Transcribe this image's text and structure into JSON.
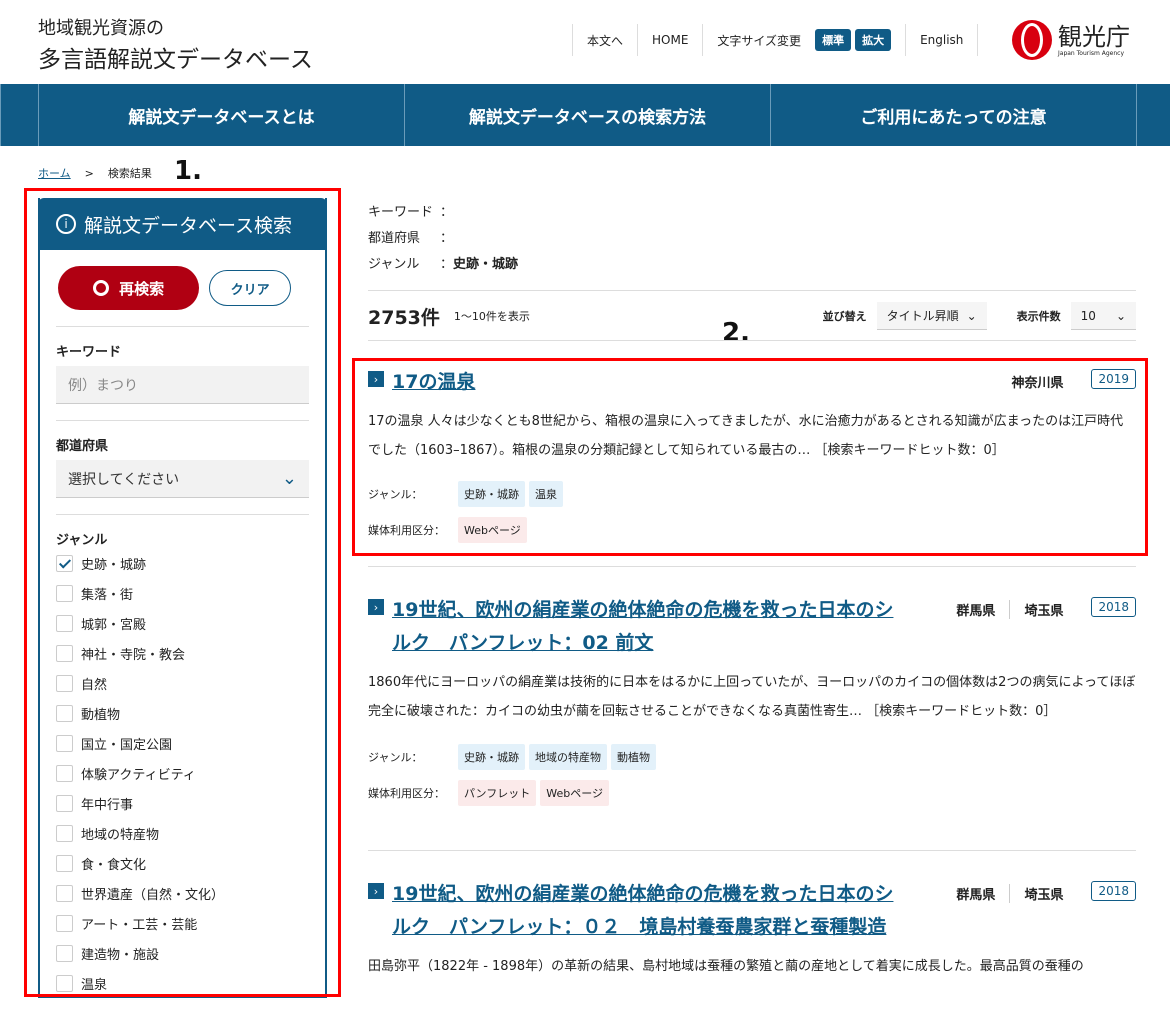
{
  "header": {
    "logo_line1": "地域観光資源の",
    "logo_line2": "多言語解説文データベース",
    "util": [
      "本文へ",
      "HOME",
      "文字サイズ変更"
    ],
    "size_std": "標準",
    "size_large": "拡大",
    "english": "English",
    "agency_name": "観光庁",
    "agency_en": "Japan Tourism Agency"
  },
  "nav": [
    "解説文データベースとは",
    "解説文データベースの検索方法",
    "ご利用にあたっての注意"
  ],
  "breadcrumb": {
    "home": "ホーム",
    "sep": ">",
    "current": "検索結果"
  },
  "annotations": {
    "a1": "1.",
    "a2": "2."
  },
  "sidebar": {
    "title": "解説文データベース検索",
    "search": "再検索",
    "clear": "クリア",
    "keyword_label": "キーワード",
    "keyword_placeholder": "例）まつり",
    "pref_label": "都道府県",
    "pref_value": "選択してください",
    "genre_label": "ジャンル",
    "genres": [
      {
        "label": "史跡・城跡",
        "checked": true
      },
      {
        "label": "集落・街",
        "checked": false
      },
      {
        "label": "城郭・宮殿",
        "checked": false
      },
      {
        "label": "神社・寺院・教会",
        "checked": false
      },
      {
        "label": "自然",
        "checked": false
      },
      {
        "label": "動植物",
        "checked": false
      },
      {
        "label": "国立・国定公園",
        "checked": false
      },
      {
        "label": "体験アクティビティ",
        "checked": false
      },
      {
        "label": "年中行事",
        "checked": false
      },
      {
        "label": "地域の特産物",
        "checked": false
      },
      {
        "label": "食・食文化",
        "checked": false
      },
      {
        "label": "世界遺産（自然・文化）",
        "checked": false
      },
      {
        "label": "アート・工芸・芸能",
        "checked": false
      },
      {
        "label": "建造物・施設",
        "checked": false
      },
      {
        "label": "温泉",
        "checked": false
      }
    ]
  },
  "criteria": {
    "keyword_label": "キーワード",
    "keyword_value": "",
    "pref_label": "都道府県",
    "pref_value": "",
    "genre_label": "ジャンル",
    "genre_value": "史跡・城跡"
  },
  "results_bar": {
    "count": "2753件",
    "range": "1〜10件を表示",
    "sort_label": "並び替え",
    "sort_value": "タイトル昇順",
    "per_page_label": "表示件数",
    "per_page_value": "10"
  },
  "results": [
    {
      "title": "17の温泉",
      "prefs": [
        "神奈川県"
      ],
      "year": "2019",
      "desc": "17の温泉 人々は少なくとも8世紀から、箱根の温泉に入ってきましたが、水に治癒力があるとされる知識が広まったのは江戸時代でした（1603–1867）。箱根の温泉の分類記録として知られている最古の… ［検索キーワードヒット数：0］",
      "genre_label": "ジャンル：",
      "genres": [
        "史跡・城跡",
        "温泉"
      ],
      "media_label": "媒体利用区分：",
      "media": [
        "Webページ"
      ]
    },
    {
      "title": "19世紀、欧州の絹産業の絶体絶命の危機を救った日本のシルク　パンフレット：02 前文",
      "prefs": [
        "群馬県",
        "埼玉県"
      ],
      "year": "2018",
      "desc": "1860年代にヨーロッパの絹産業は技術的に日本をはるかに上回っていたが、ヨーロッパのカイコの個体数は2つの病気によってほぼ完全に破壊された：カイコの幼虫が繭を回転させることができなくなる真菌性寄生… ［検索キーワードヒット数：0］",
      "genre_label": "ジャンル：",
      "genres": [
        "史跡・城跡",
        "地域の特産物",
        "動植物"
      ],
      "media_label": "媒体利用区分：",
      "media": [
        "パンフレット",
        "Webページ"
      ]
    },
    {
      "title": "19世紀、欧州の絹産業の絶体絶命の危機を救った日本のシルク　パンフレット：０２　境島村養蚕農家群と蚕種製造",
      "prefs": [
        "群馬県",
        "埼玉県"
      ],
      "year": "2018",
      "desc": "田島弥平（1822年 - 1898年）の革新の結果、島村地域は蚕種の繁殖と繭の産地として着実に成長した。最高品質の蚕種の"
    }
  ]
}
